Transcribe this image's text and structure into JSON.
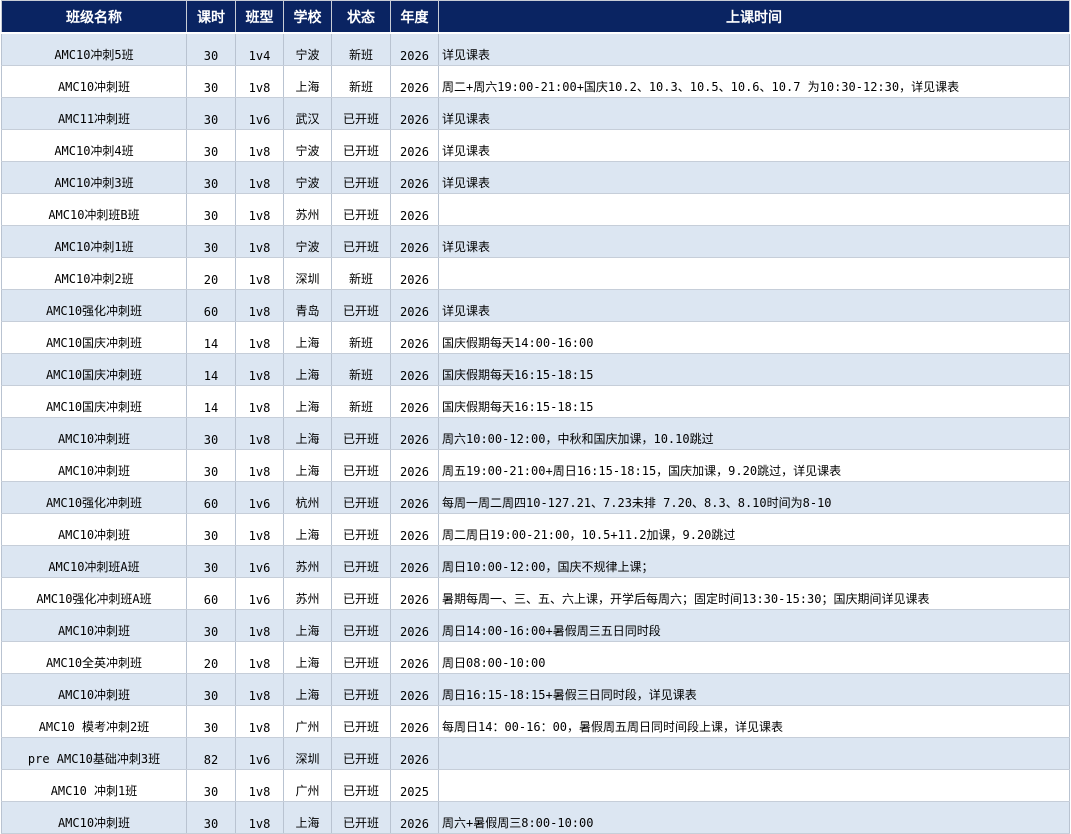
{
  "headers": [
    "班级名称",
    "课时",
    "班型",
    "学校",
    "状态",
    "年度",
    "上课时间"
  ],
  "rows": [
    {
      "name": "AMC10冲刺5班",
      "hours": "30",
      "type": "1v4",
      "school": "宁波",
      "status": "新班",
      "year": "2026",
      "time": "详见课表"
    },
    {
      "name": "AMC10冲刺班",
      "hours": "30",
      "type": "1v8",
      "school": "上海",
      "status": "新班",
      "year": "2026",
      "time": "周二+周六19:00-21:00+国庆10.2、10.3、10.5、10.6、10.7 为10:30-12:30，详见课表"
    },
    {
      "name": "AMC11冲刺班",
      "hours": "30",
      "type": "1v6",
      "school": "武汉",
      "status": "已开班",
      "year": "2026",
      "time": "详见课表"
    },
    {
      "name": "AMC10冲刺4班",
      "hours": "30",
      "type": "1v8",
      "school": "宁波",
      "status": "已开班",
      "year": "2026",
      "time": "详见课表"
    },
    {
      "name": "AMC10冲刺3班",
      "hours": "30",
      "type": "1v8",
      "school": "宁波",
      "status": "已开班",
      "year": "2026",
      "time": "详见课表"
    },
    {
      "name": "AMC10冲刺班B班",
      "hours": "30",
      "type": "1v8",
      "school": "苏州",
      "status": "已开班",
      "year": "2026",
      "time": ""
    },
    {
      "name": "AMC10冲刺1班",
      "hours": "30",
      "type": "1v8",
      "school": "宁波",
      "status": "已开班",
      "year": "2026",
      "time": "详见课表"
    },
    {
      "name": "AMC10冲刺2班",
      "hours": "20",
      "type": "1v8",
      "school": "深圳",
      "status": "新班",
      "year": "2026",
      "time": ""
    },
    {
      "name": "AMC10强化冲刺班",
      "hours": "60",
      "type": "1v8",
      "school": "青岛",
      "status": "已开班",
      "year": "2026",
      "time": "详见课表"
    },
    {
      "name": "AMC10国庆冲刺班",
      "hours": "14",
      "type": "1v8",
      "school": "上海",
      "status": "新班",
      "year": "2026",
      "time": "国庆假期每天14:00-16:00"
    },
    {
      "name": "AMC10国庆冲刺班",
      "hours": "14",
      "type": "1v8",
      "school": "上海",
      "status": "新班",
      "year": "2026",
      "time": "国庆假期每天16:15-18:15"
    },
    {
      "name": "AMC10国庆冲刺班",
      "hours": "14",
      "type": "1v8",
      "school": "上海",
      "status": "新班",
      "year": "2026",
      "time": "国庆假期每天16:15-18:15"
    },
    {
      "name": "AMC10冲刺班",
      "hours": "30",
      "type": "1v8",
      "school": "上海",
      "status": "已开班",
      "year": "2026",
      "time": "周六10:00-12:00，中秋和国庆加课，10.10跳过"
    },
    {
      "name": "AMC10冲刺班",
      "hours": "30",
      "type": "1v8",
      "school": "上海",
      "status": "已开班",
      "year": "2026",
      "time": "周五19:00-21:00+周日16:15-18:15，国庆加课，9.20跳过，详见课表"
    },
    {
      "name": "AMC10强化冲刺班",
      "hours": "60",
      "type": "1v6",
      "school": "杭州",
      "status": "已开班",
      "year": "2026",
      "time": "每周一周二周四10-127.21、7.23未排 7.20、8.3、8.10时间为8-10"
    },
    {
      "name": "AMC10冲刺班",
      "hours": "30",
      "type": "1v8",
      "school": "上海",
      "status": "已开班",
      "year": "2026",
      "time": "周二周日19:00-21:00，10.5+11.2加课，9.20跳过"
    },
    {
      "name": "AMC10冲刺班A班",
      "hours": "30",
      "type": "1v6",
      "school": "苏州",
      "status": "已开班",
      "year": "2026",
      "time": "周日10:00-12:00，国庆不规律上课；"
    },
    {
      "name": "AMC10强化冲刺班A班",
      "hours": "60",
      "type": "1v6",
      "school": "苏州",
      "status": "已开班",
      "year": "2026",
      "time": "暑期每周一、三、五、六上课，开学后每周六；固定时间13:30-15:30；国庆期间详见课表"
    },
    {
      "name": "AMC10冲刺班",
      "hours": "30",
      "type": "1v8",
      "school": "上海",
      "status": "已开班",
      "year": "2026",
      "time": "周日14:00-16:00+暑假周三五日同时段"
    },
    {
      "name": "AMC10全英冲刺班",
      "hours": "20",
      "type": "1v8",
      "school": "上海",
      "status": "已开班",
      "year": "2026",
      "time": "周日08:00-10:00"
    },
    {
      "name": "AMC10冲刺班",
      "hours": "30",
      "type": "1v8",
      "school": "上海",
      "status": "已开班",
      "year": "2026",
      "time": "周日16:15-18:15+暑假三日同时段，详见课表"
    },
    {
      "name": "AMC10 模考冲刺2班",
      "hours": "30",
      "type": "1v8",
      "school": "广州",
      "status": "已开班",
      "year": "2026",
      "time": "每周日14：00-16：00，暑假周五周日同时间段上课，详见课表"
    },
    {
      "name": "pre  AMC10基础冲刺3班",
      "hours": "82",
      "type": "1v6",
      "school": "深圳",
      "status": "已开班",
      "year": "2026",
      "time": ""
    },
    {
      "name": "AMC10 冲刺1班",
      "hours": "30",
      "type": "1v8",
      "school": "广州",
      "status": "已开班",
      "year": "2025",
      "time": ""
    },
    {
      "name": "AMC10冲刺班",
      "hours": "30",
      "type": "1v8",
      "school": "上海",
      "status": "已开班",
      "year": "2026",
      "time": "周六+暑假周三8:00-10:00"
    }
  ],
  "colors": {
    "header_bg": "#0a2462",
    "header_text": "#ffffff",
    "row_alt": "#dce6f2",
    "row_plain": "#ffffff"
  }
}
